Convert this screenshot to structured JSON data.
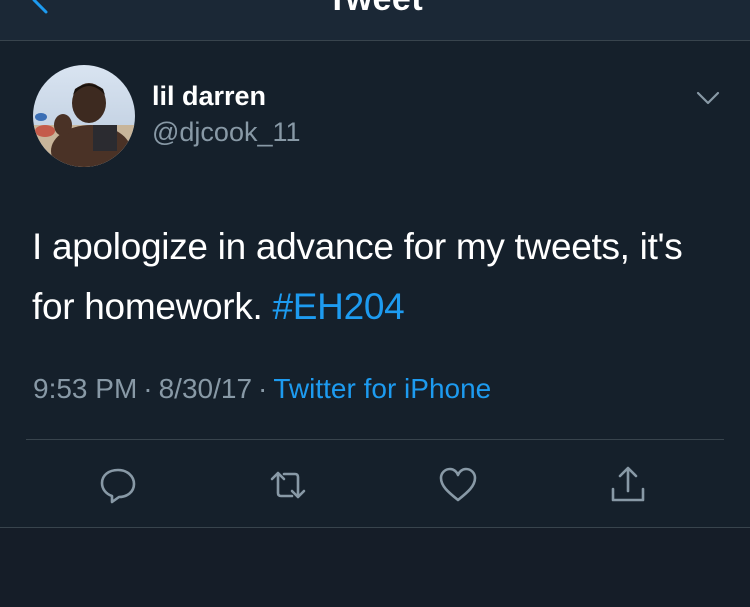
{
  "header": {
    "title": "Tweet"
  },
  "tweet": {
    "display_name": "lil darren",
    "username": "@djcook_11",
    "text_before_hashtag": "I apologize in advance for my tweets, it's for homework. ",
    "hashtag": "#EH204",
    "time": "9:53 PM",
    "date": "8/30/17",
    "separator": "·",
    "source": "Twitter for iPhone"
  },
  "colors": {
    "background": "#15202b",
    "link": "#1d9bf0",
    "muted": "#8899a6",
    "divider": "#38444d"
  },
  "icons": {
    "back": "chevron-left-icon",
    "more": "chevron-down-icon",
    "reply": "reply-icon",
    "retweet": "retweet-icon",
    "like": "heart-icon",
    "share": "share-icon"
  }
}
